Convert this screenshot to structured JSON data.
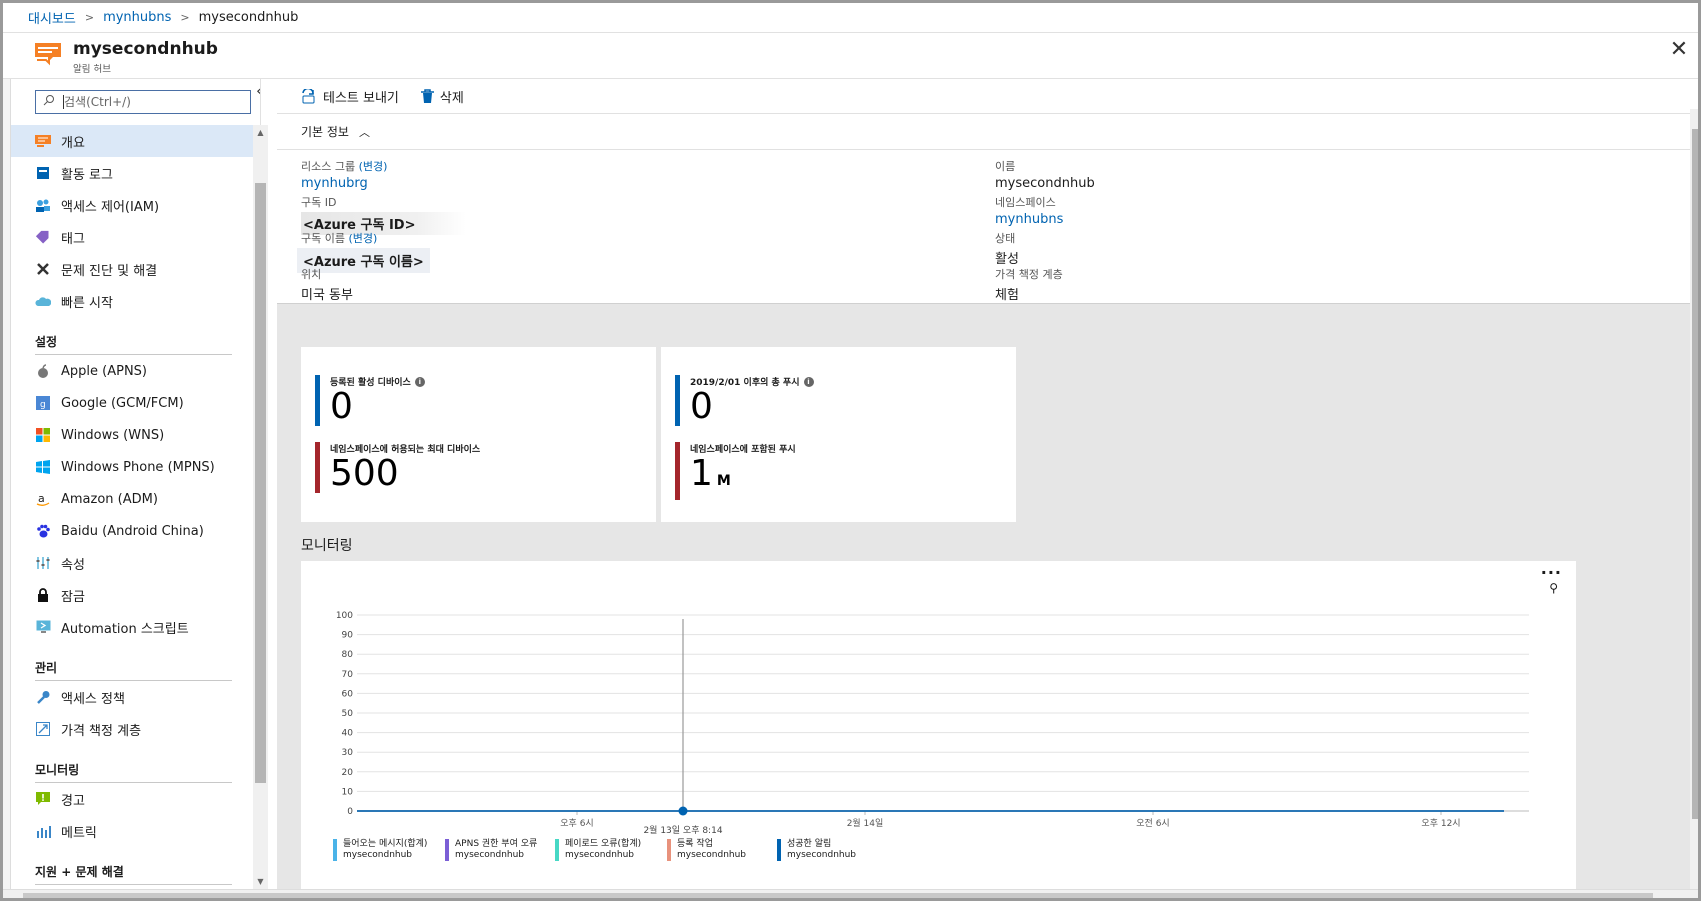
{
  "breadcrumb": {
    "items": [
      "대시보드",
      "mynhubns"
    ],
    "current": "mysecondnhub"
  },
  "header": {
    "title": "mysecondnhub",
    "subtitle": "알림 허브"
  },
  "search": {
    "placeholder": "검색(Ctrl+/)"
  },
  "sidebar": {
    "items": [
      {
        "label": "개요",
        "icon": "overview-icon",
        "active": true
      },
      {
        "label": "활동 로그",
        "icon": "activity-log-icon"
      },
      {
        "label": "액세스 제어(IAM)",
        "icon": "iam-icon"
      },
      {
        "label": "태그",
        "icon": "tag-icon"
      },
      {
        "label": "문제 진단 및 해결",
        "icon": "wrench-icon"
      },
      {
        "label": "빠른 시작",
        "icon": "cloud-icon"
      }
    ],
    "settings_title": "설정",
    "settings": [
      {
        "label": "Apple (APNS)",
        "icon": "apple-icon"
      },
      {
        "label": "Google (GCM/FCM)",
        "icon": "google-icon"
      },
      {
        "label": "Windows (WNS)",
        "icon": "windows-icon"
      },
      {
        "label": "Windows Phone (MPNS)",
        "icon": "windows-phone-icon"
      },
      {
        "label": "Amazon (ADM)",
        "icon": "amazon-icon"
      },
      {
        "label": "Baidu (Android China)",
        "icon": "baidu-icon"
      },
      {
        "label": "속성",
        "icon": "properties-icon"
      },
      {
        "label": "잠금",
        "icon": "lock-icon"
      },
      {
        "label": "Automation 스크립트",
        "icon": "automation-icon"
      }
    ],
    "manage_title": "관리",
    "manage": [
      {
        "label": "액세스 정책",
        "icon": "key-icon"
      },
      {
        "label": "가격 책정 계층",
        "icon": "pricing-icon"
      }
    ],
    "monitoring_title": "모니터링",
    "monitoring": [
      {
        "label": "경고",
        "icon": "alert-icon"
      },
      {
        "label": "메트릭",
        "icon": "metrics-icon"
      }
    ],
    "support_title": "지원 + 문제 해결"
  },
  "toolbar": {
    "send_test": "테스트 보내기",
    "delete": "삭제"
  },
  "essentials": {
    "title": "기본 정보",
    "resource_group_label": "리소스 그룹",
    "change": "(변경)",
    "resource_group": "mynhubrg",
    "subscription_id_label": "구독 ID",
    "subscription_id": "<Azure 구독 ID>",
    "subscription_name_label": "구독 이름",
    "subscription_name": "<Azure 구독 이름>",
    "location_label": "위치",
    "location": "미국 동부",
    "name_label": "이름",
    "name": "mysecondnhub",
    "namespace_label": "네임스페이스",
    "namespace": "mynhubns",
    "status_label": "상태",
    "status": "활성",
    "pricing_label": "가격 책정 계층",
    "pricing": "체험"
  },
  "tiles": {
    "active_devices_label": "등록된 활성 디바이스",
    "active_devices": "0",
    "max_devices_label": "네임스페이스에 허용되는 최대 디바이스",
    "max_devices": "500",
    "total_push_label": "2019/2/01 이후의 총 푸시",
    "total_push": "0",
    "included_push_label": "네임스페이스에 포함된 푸시",
    "included_push": "1",
    "included_push_unit": "M"
  },
  "monitoring": {
    "title": "모니터링",
    "more": "···"
  },
  "chart_data": {
    "type": "line",
    "y_ticks": [
      0,
      10,
      20,
      30,
      40,
      50,
      60,
      70,
      80,
      90,
      100
    ],
    "ylim": [
      0,
      100
    ],
    "x_ticks": [
      "오후 6시",
      "2월 14일",
      "오전 6시",
      "오후 12시"
    ],
    "cursor_label": "2월 13일 오후 8:14",
    "series": [
      {
        "name": "들어오는 메시지(합계)",
        "sub": "mysecondnhub",
        "color": "#4ab3e8",
        "values": [
          0,
          0
        ]
      },
      {
        "name": "APNS 권한 부여 오류",
        "sub": "mysecondnhub",
        "color": "#7b5fd6",
        "values": [
          0,
          0
        ]
      },
      {
        "name": "페이로드 오류(합계)",
        "sub": "mysecondnhub",
        "color": "#47d8c5",
        "values": [
          0,
          0
        ]
      },
      {
        "name": "등록 작업",
        "sub": "mysecondnhub",
        "color": "#e8927c",
        "values": [
          0,
          0
        ]
      },
      {
        "name": "성공한 알림",
        "sub": "mysecondnhub",
        "color": "#0063b1",
        "values": [
          0,
          0
        ]
      }
    ]
  }
}
